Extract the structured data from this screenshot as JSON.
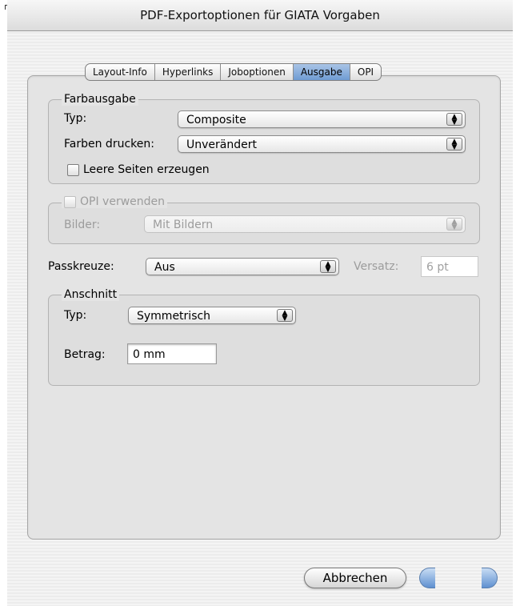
{
  "window": {
    "title": "PDF-Exportoptionen für GIATA Vorgaben"
  },
  "tabs": [
    {
      "label": "Layout-Info",
      "active": false
    },
    {
      "label": "Hyperlinks",
      "active": false
    },
    {
      "label": "Joboptionen",
      "active": false
    },
    {
      "label": "Ausgabe",
      "active": true
    },
    {
      "label": "OPI",
      "active": false
    }
  ],
  "farbausgabe": {
    "legend": "Farbausgabe",
    "typ_label": "Typ:",
    "typ_value": "Composite",
    "farben_label": "Farben drucken:",
    "farben_value": "Unverändert",
    "leere_seiten_label": "Leere Seiten erzeugen",
    "leere_seiten_checked": false
  },
  "opi": {
    "legend": "OPI verwenden",
    "enabled": false,
    "bilder_label": "Bilder:",
    "bilder_value": "Mit Bildern"
  },
  "passkreuze": {
    "label": "Passkreuze:",
    "value": "Aus",
    "versatz_label": "Versatz:",
    "versatz_value": "6 pt"
  },
  "anschnitt": {
    "legend": "Anschnitt",
    "typ_label": "Typ:",
    "typ_value": "Symmetrisch",
    "betrag_label": "Betrag:",
    "betrag_value": "0 mm"
  },
  "buttons": {
    "cancel_label": "Abbrechen"
  },
  "icons": {
    "popup_arrows": "up-down-arrows-icon"
  },
  "colors": {
    "active_tab": "#7fa7d9",
    "default_button": "#5f90d0"
  }
}
